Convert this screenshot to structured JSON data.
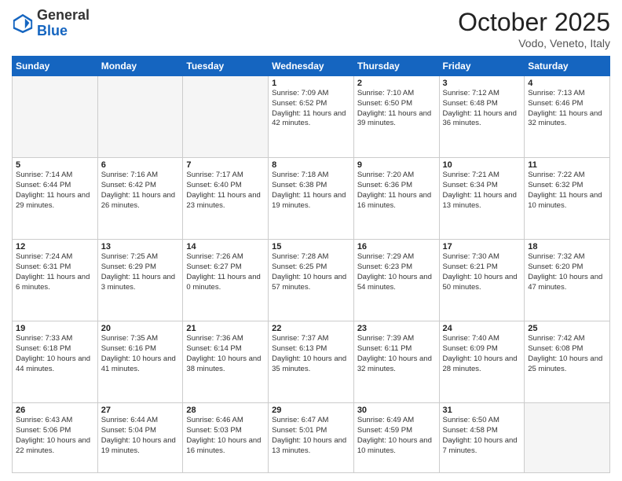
{
  "header": {
    "logo_general": "General",
    "logo_blue": "Blue",
    "month_title": "October 2025",
    "location": "Vodo, Veneto, Italy"
  },
  "days_of_week": [
    "Sunday",
    "Monday",
    "Tuesday",
    "Wednesday",
    "Thursday",
    "Friday",
    "Saturday"
  ],
  "weeks": [
    [
      {
        "num": "",
        "info": ""
      },
      {
        "num": "",
        "info": ""
      },
      {
        "num": "",
        "info": ""
      },
      {
        "num": "1",
        "info": "Sunrise: 7:09 AM\nSunset: 6:52 PM\nDaylight: 11 hours and 42 minutes."
      },
      {
        "num": "2",
        "info": "Sunrise: 7:10 AM\nSunset: 6:50 PM\nDaylight: 11 hours and 39 minutes."
      },
      {
        "num": "3",
        "info": "Sunrise: 7:12 AM\nSunset: 6:48 PM\nDaylight: 11 hours and 36 minutes."
      },
      {
        "num": "4",
        "info": "Sunrise: 7:13 AM\nSunset: 6:46 PM\nDaylight: 11 hours and 32 minutes."
      }
    ],
    [
      {
        "num": "5",
        "info": "Sunrise: 7:14 AM\nSunset: 6:44 PM\nDaylight: 11 hours and 29 minutes."
      },
      {
        "num": "6",
        "info": "Sunrise: 7:16 AM\nSunset: 6:42 PM\nDaylight: 11 hours and 26 minutes."
      },
      {
        "num": "7",
        "info": "Sunrise: 7:17 AM\nSunset: 6:40 PM\nDaylight: 11 hours and 23 minutes."
      },
      {
        "num": "8",
        "info": "Sunrise: 7:18 AM\nSunset: 6:38 PM\nDaylight: 11 hours and 19 minutes."
      },
      {
        "num": "9",
        "info": "Sunrise: 7:20 AM\nSunset: 6:36 PM\nDaylight: 11 hours and 16 minutes."
      },
      {
        "num": "10",
        "info": "Sunrise: 7:21 AM\nSunset: 6:34 PM\nDaylight: 11 hours and 13 minutes."
      },
      {
        "num": "11",
        "info": "Sunrise: 7:22 AM\nSunset: 6:32 PM\nDaylight: 11 hours and 10 minutes."
      }
    ],
    [
      {
        "num": "12",
        "info": "Sunrise: 7:24 AM\nSunset: 6:31 PM\nDaylight: 11 hours and 6 minutes."
      },
      {
        "num": "13",
        "info": "Sunrise: 7:25 AM\nSunset: 6:29 PM\nDaylight: 11 hours and 3 minutes."
      },
      {
        "num": "14",
        "info": "Sunrise: 7:26 AM\nSunset: 6:27 PM\nDaylight: 11 hours and 0 minutes."
      },
      {
        "num": "15",
        "info": "Sunrise: 7:28 AM\nSunset: 6:25 PM\nDaylight: 10 hours and 57 minutes."
      },
      {
        "num": "16",
        "info": "Sunrise: 7:29 AM\nSunset: 6:23 PM\nDaylight: 10 hours and 54 minutes."
      },
      {
        "num": "17",
        "info": "Sunrise: 7:30 AM\nSunset: 6:21 PM\nDaylight: 10 hours and 50 minutes."
      },
      {
        "num": "18",
        "info": "Sunrise: 7:32 AM\nSunset: 6:20 PM\nDaylight: 10 hours and 47 minutes."
      }
    ],
    [
      {
        "num": "19",
        "info": "Sunrise: 7:33 AM\nSunset: 6:18 PM\nDaylight: 10 hours and 44 minutes."
      },
      {
        "num": "20",
        "info": "Sunrise: 7:35 AM\nSunset: 6:16 PM\nDaylight: 10 hours and 41 minutes."
      },
      {
        "num": "21",
        "info": "Sunrise: 7:36 AM\nSunset: 6:14 PM\nDaylight: 10 hours and 38 minutes."
      },
      {
        "num": "22",
        "info": "Sunrise: 7:37 AM\nSunset: 6:13 PM\nDaylight: 10 hours and 35 minutes."
      },
      {
        "num": "23",
        "info": "Sunrise: 7:39 AM\nSunset: 6:11 PM\nDaylight: 10 hours and 32 minutes."
      },
      {
        "num": "24",
        "info": "Sunrise: 7:40 AM\nSunset: 6:09 PM\nDaylight: 10 hours and 28 minutes."
      },
      {
        "num": "25",
        "info": "Sunrise: 7:42 AM\nSunset: 6:08 PM\nDaylight: 10 hours and 25 minutes."
      }
    ],
    [
      {
        "num": "26",
        "info": "Sunrise: 6:43 AM\nSunset: 5:06 PM\nDaylight: 10 hours and 22 minutes."
      },
      {
        "num": "27",
        "info": "Sunrise: 6:44 AM\nSunset: 5:04 PM\nDaylight: 10 hours and 19 minutes."
      },
      {
        "num": "28",
        "info": "Sunrise: 6:46 AM\nSunset: 5:03 PM\nDaylight: 10 hours and 16 minutes."
      },
      {
        "num": "29",
        "info": "Sunrise: 6:47 AM\nSunset: 5:01 PM\nDaylight: 10 hours and 13 minutes."
      },
      {
        "num": "30",
        "info": "Sunrise: 6:49 AM\nSunset: 4:59 PM\nDaylight: 10 hours and 10 minutes."
      },
      {
        "num": "31",
        "info": "Sunrise: 6:50 AM\nSunset: 4:58 PM\nDaylight: 10 hours and 7 minutes."
      },
      {
        "num": "",
        "info": ""
      }
    ]
  ]
}
